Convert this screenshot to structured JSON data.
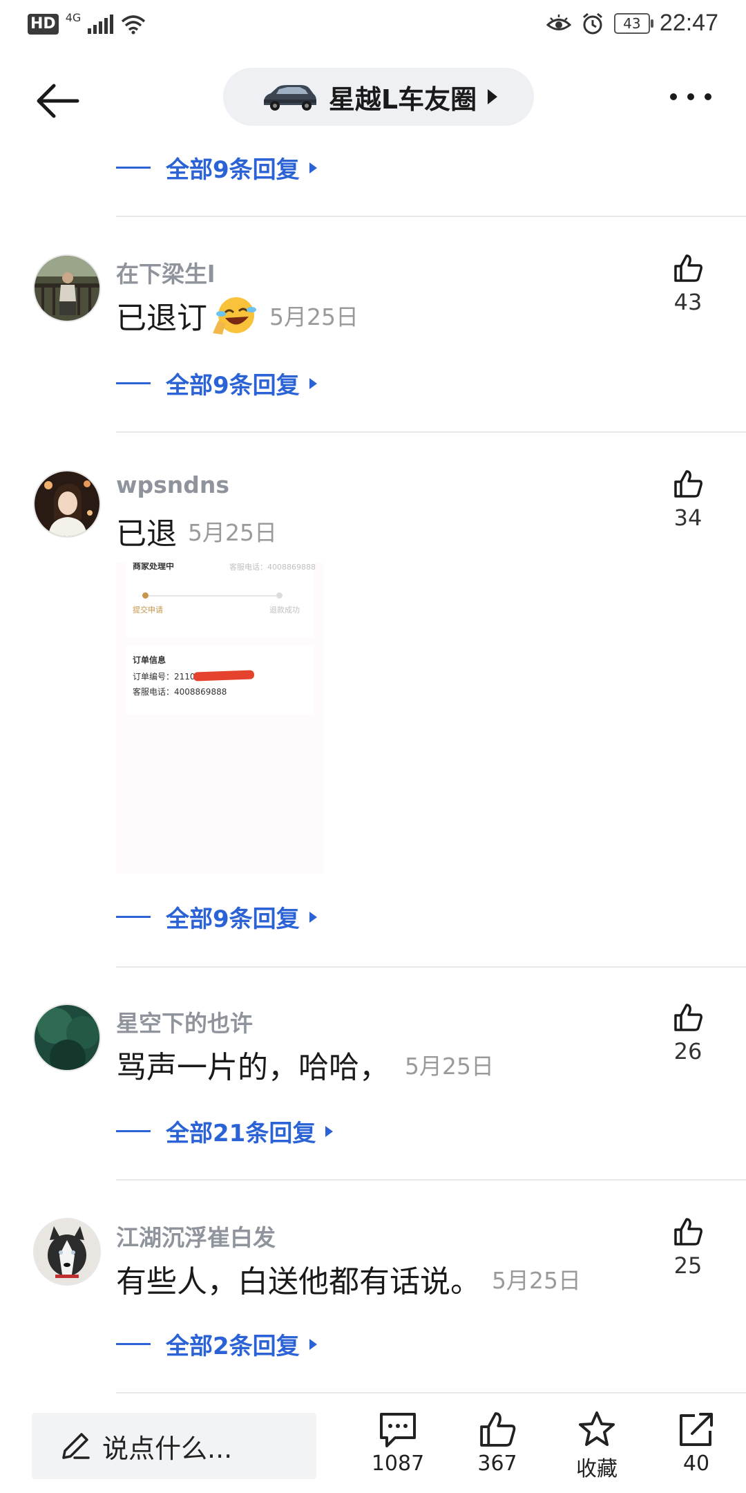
{
  "status_bar": {
    "hd": "HD",
    "network": "4G",
    "battery": "43",
    "time": "22:47"
  },
  "header": {
    "title": "星越L车友圈"
  },
  "top_replies_link": "全部9条回复",
  "comments": [
    {
      "username": "在下梁生l",
      "text": "已退订",
      "date": "5月25日",
      "likes": "43",
      "replies_link": "全部9条回复"
    },
    {
      "username": "wpsndns",
      "text": "已退",
      "date": "5月25日",
      "likes": "34",
      "replies_link": "全部9条回复",
      "image_text": {
        "status": "商家处理中",
        "service_phone_top": "客服电话：4008869888",
        "step1": "提交申请",
        "step2": "退款成功",
        "order_info": "订单信息",
        "order_no": "订单编号：21109118",
        "service_phone": "客服电话：4008869888"
      }
    },
    {
      "username": "星空下的也许",
      "text": "骂声一片的，哈哈，",
      "date": "5月25日",
      "likes": "26",
      "replies_link": "全部21条回复"
    },
    {
      "username": "江湖沉浮崔白发",
      "text": "有些人，白送他都有话说。",
      "date": "5月25日",
      "likes": "25",
      "replies_link": "全部2条回复"
    }
  ],
  "bottom_bar": {
    "input_placeholder": "说点什么...",
    "comments_count": "1087",
    "likes_count": "367",
    "favorite_label": "收藏",
    "share_count": "40"
  },
  "colors": {
    "link_blue": "#2b63d6",
    "username_gray": "#8e939c",
    "pill_bg": "#eef0f4"
  }
}
